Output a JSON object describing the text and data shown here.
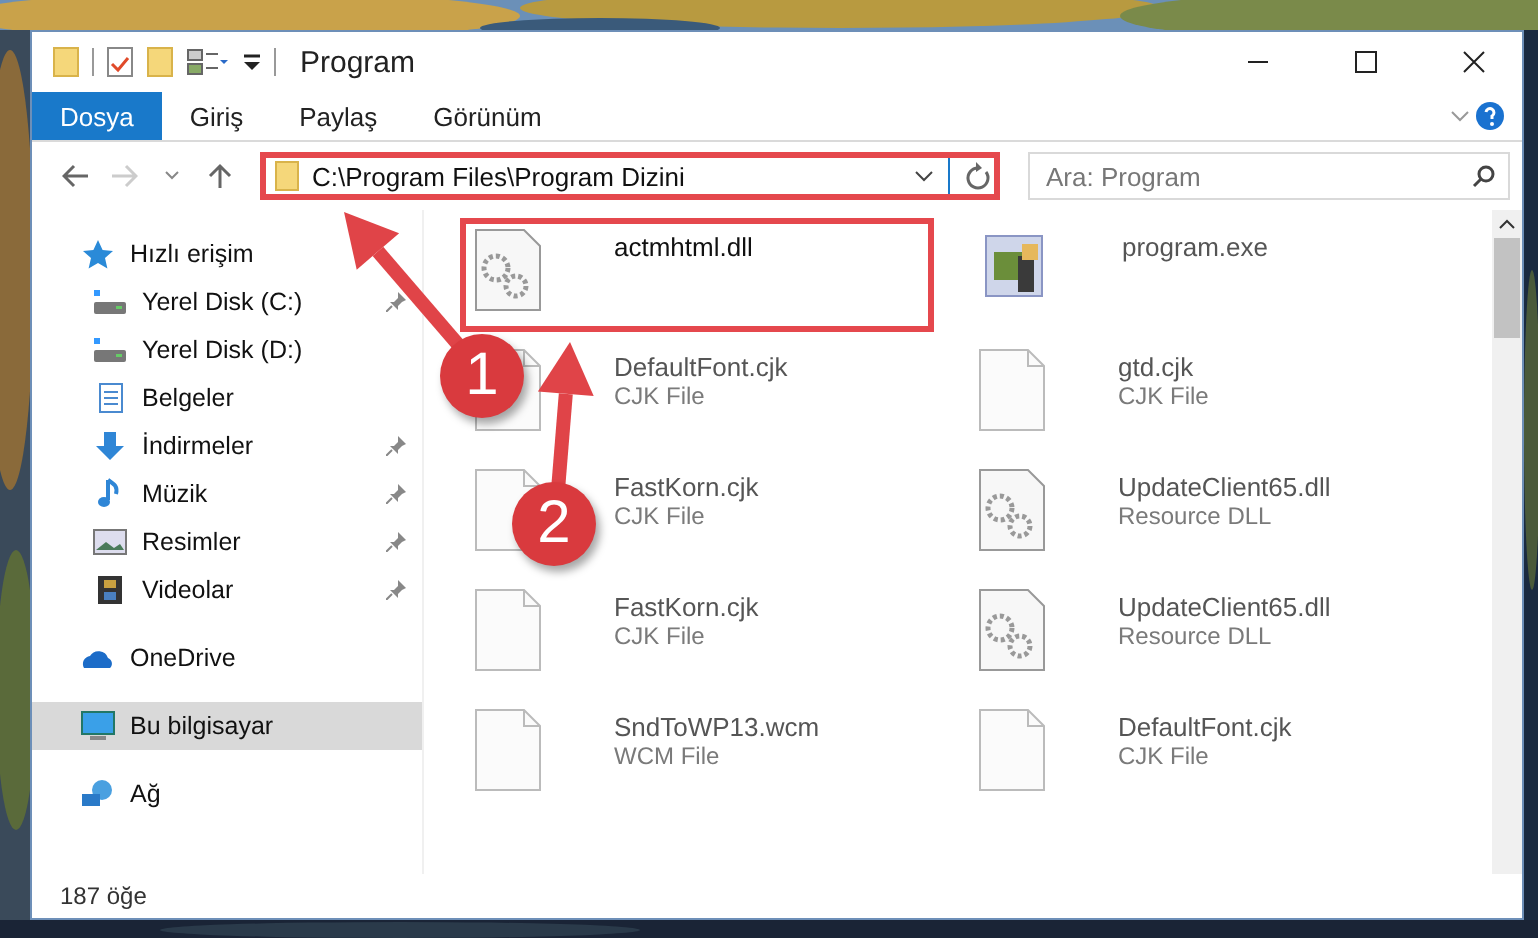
{
  "window": {
    "title": "Program"
  },
  "ribbon": {
    "tabs": [
      {
        "label": "Dosya",
        "selected": true
      },
      {
        "label": "Giriş",
        "selected": false
      },
      {
        "label": "Paylaş",
        "selected": false
      },
      {
        "label": "Görünüm",
        "selected": false
      }
    ]
  },
  "address_bar": {
    "path": "C:\\Program Files\\Program Dizini",
    "highlighted": true
  },
  "search": {
    "placeholder": "Ara: Program"
  },
  "sidebar": {
    "items": [
      {
        "label": "Hızlı erişim",
        "kind": "star",
        "selected": false,
        "children": [
          {
            "label": "Yerel Disk (C:)",
            "kind": "drive",
            "selected": false,
            "pinned": true
          },
          {
            "label": "Yerel Disk (D:)",
            "kind": "drive",
            "selected": false,
            "pinned": false
          },
          {
            "label": "Belgeler",
            "kind": "docs",
            "selected": false,
            "pinned": false
          },
          {
            "label": "İndirmeler",
            "kind": "download",
            "selected": false,
            "pinned": true
          },
          {
            "label": "Müzik",
            "kind": "music",
            "selected": false,
            "pinned": true
          },
          {
            "label": "Resimler",
            "kind": "pictures",
            "selected": false,
            "pinned": true
          },
          {
            "label": "Videolar",
            "kind": "video",
            "selected": false,
            "pinned": true
          }
        ]
      },
      {
        "label": "OneDrive",
        "kind": "cloud",
        "selected": false
      },
      {
        "label": "Bu bilgisayar",
        "kind": "computer",
        "selected": true
      },
      {
        "label": "Ağ",
        "kind": "network",
        "selected": false
      }
    ]
  },
  "files": [
    {
      "name": "actmhtml.dll",
      "kind": "gear",
      "highlighted": true
    },
    {
      "name": "program.exe",
      "kind": "app",
      "highlighted": false
    },
    {
      "name": "DefaultFont.cjk",
      "type": "CJK File",
      "kind": "blank",
      "highlighted": false
    },
    {
      "name": "gtd.cjk",
      "type": "CJK File",
      "kind": "blank",
      "highlighted": false
    },
    {
      "name": "FastKorn.cjk",
      "type": "CJK File",
      "kind": "blank",
      "highlighted": false
    },
    {
      "name": "UpdateClient65.dll",
      "type": "Resource DLL",
      "kind": "gear",
      "highlighted": false
    },
    {
      "name": "FastKorn.cjk",
      "type": "CJK File",
      "kind": "blank",
      "highlighted": false
    },
    {
      "name": "UpdateClient65.dll",
      "type": "Resource DLL",
      "kind": "gear",
      "highlighted": false
    },
    {
      "name": "SndToWP13.wcm",
      "type": "WCM File",
      "kind": "blank",
      "highlighted": false
    },
    {
      "name": "DefaultFont.cjk",
      "type": "CJK File",
      "kind": "blank",
      "highlighted": false
    }
  ],
  "annotations": [
    {
      "label": "1"
    },
    {
      "label": "2"
    }
  ],
  "status_bar": {
    "count": "187 öğe"
  }
}
